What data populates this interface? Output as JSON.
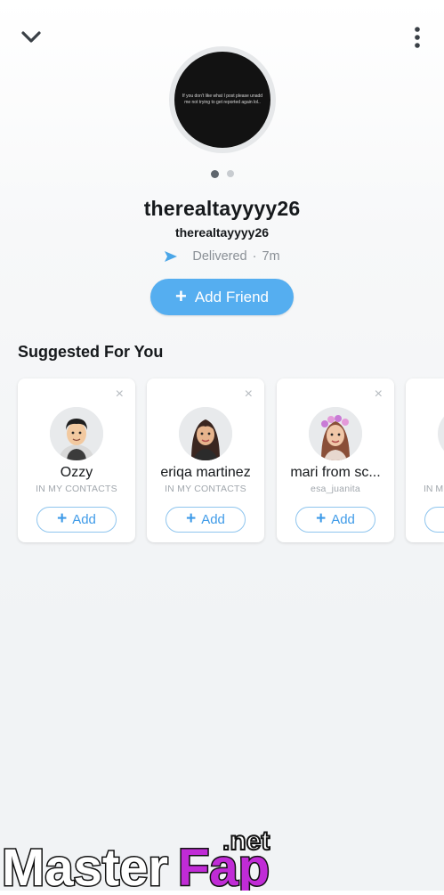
{
  "header": {
    "back_icon": "chevron-down-icon",
    "more_icon": "more-vertical-icon"
  },
  "story": {
    "text": "If you don't like what I post please unadd me not trying to get reported again lol.."
  },
  "pagination": {
    "total": 2,
    "active": 1
  },
  "profile": {
    "display_name": "therealtayyyy26",
    "username": "therealtayyyy26",
    "status": "Delivered",
    "separator": "·",
    "time_ago": "7m",
    "status_color": "#4aa6e8"
  },
  "add_friend": {
    "label": "Add Friend",
    "plus": "+",
    "color": "#55aef0"
  },
  "suggested": {
    "title": "Suggested For You",
    "close": "×",
    "add_plus": "+",
    "add_label": "Add",
    "cards": [
      {
        "name": "Ozzy",
        "subtitle": "IN MY CONTACTS",
        "avatar_icon": "bitmoji-male-avatar"
      },
      {
        "name": "eriqa martinez",
        "subtitle": "IN MY CONTACTS",
        "avatar_icon": "bitmoji-female-avatar"
      },
      {
        "name": "mari from sc...",
        "subtitle": "esa_juanita",
        "avatar_icon": "bitmoji-female-flower-crown-avatar"
      },
      {
        "name": "",
        "subtitle": "IN M",
        "avatar_icon": "bitmoji-avatar"
      }
    ]
  },
  "watermark": {
    "brand_part1": "Master",
    "brand_part2": "Fap",
    "suffix": ".net"
  }
}
